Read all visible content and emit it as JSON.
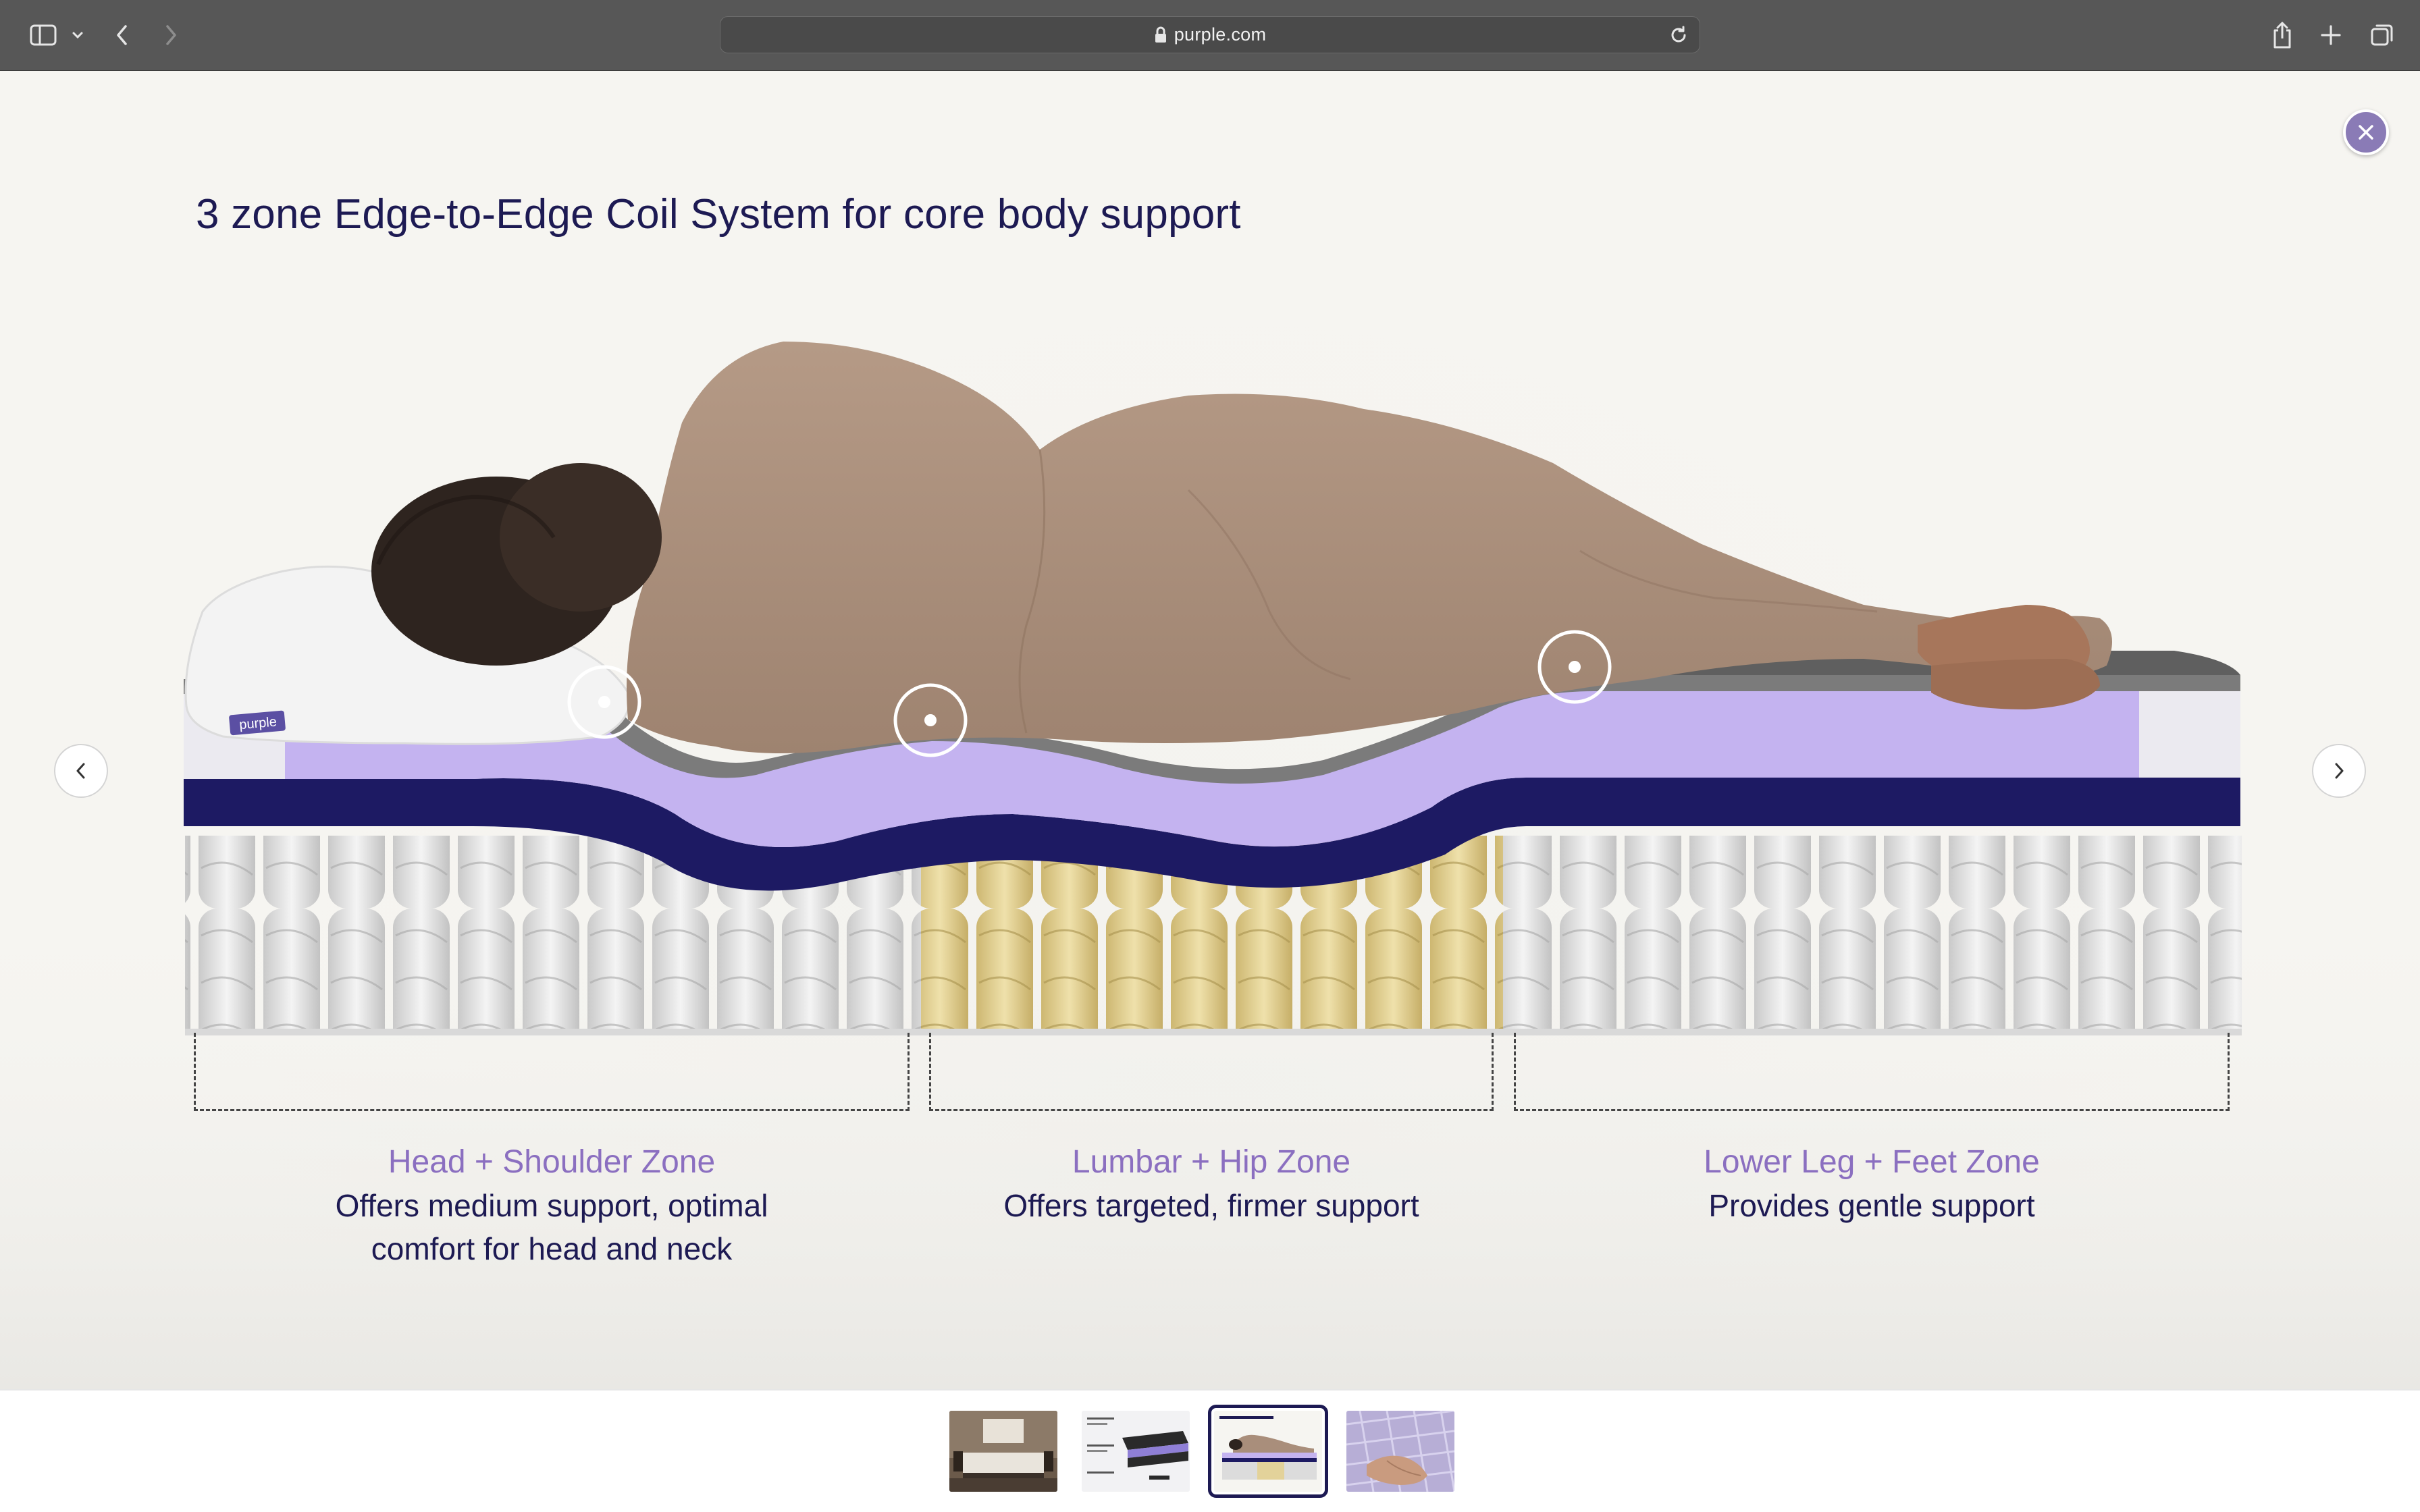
{
  "browser": {
    "url": "purple.com"
  },
  "lightbox": {
    "headline": "3 zone Edge-to-Edge Coil System for core body support",
    "pillow_logo": "purple"
  },
  "zones": [
    {
      "title": "Head + Shoulder Zone",
      "desc_line1": "Offers medium support, optimal",
      "desc_line2": "comfort for head and neck"
    },
    {
      "title": "Lumbar + Hip Zone",
      "desc_line1": "Offers targeted, firmer support",
      "desc_line2": ""
    },
    {
      "title": "Lower Leg + Feet Zone",
      "desc_line1": "Provides gentle support",
      "desc_line2": ""
    }
  ],
  "thumbnails": {
    "count": 4,
    "active_index": 2
  },
  "colors": {
    "brand_navy": "#1d1a53",
    "brand_lavender": "#b9a6ec",
    "zone_title": "#8b6fc0",
    "firm_coil": "#e3d29a"
  }
}
